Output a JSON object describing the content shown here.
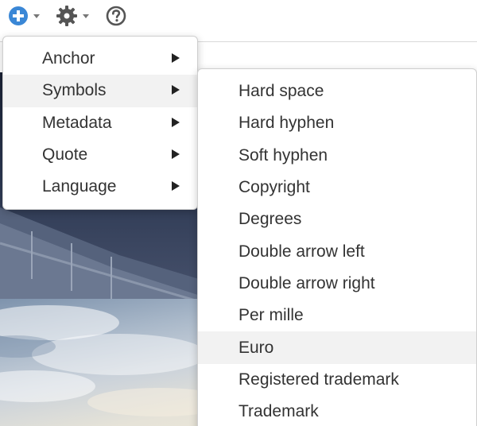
{
  "toolbar": {
    "add_icon": "plus-circle-icon",
    "settings_icon": "gear-icon",
    "help_icon": "question-circle-icon",
    "accent_color": "#3a87d6"
  },
  "menu": {
    "items": [
      {
        "label": "Anchor"
      },
      {
        "label": "Symbols"
      },
      {
        "label": "Metadata"
      },
      {
        "label": "Quote"
      },
      {
        "label": "Language"
      }
    ],
    "active_index": 1
  },
  "submenu": {
    "items": [
      {
        "label": "Hard space"
      },
      {
        "label": "Hard hyphen"
      },
      {
        "label": "Soft hyphen"
      },
      {
        "label": "Copyright"
      },
      {
        "label": "Degrees"
      },
      {
        "label": "Double arrow left"
      },
      {
        "label": "Double arrow right"
      },
      {
        "label": "Per mille"
      },
      {
        "label": "Euro"
      },
      {
        "label": "Registered trademark"
      },
      {
        "label": "Trademark"
      }
    ],
    "highlighted_index": 8
  }
}
